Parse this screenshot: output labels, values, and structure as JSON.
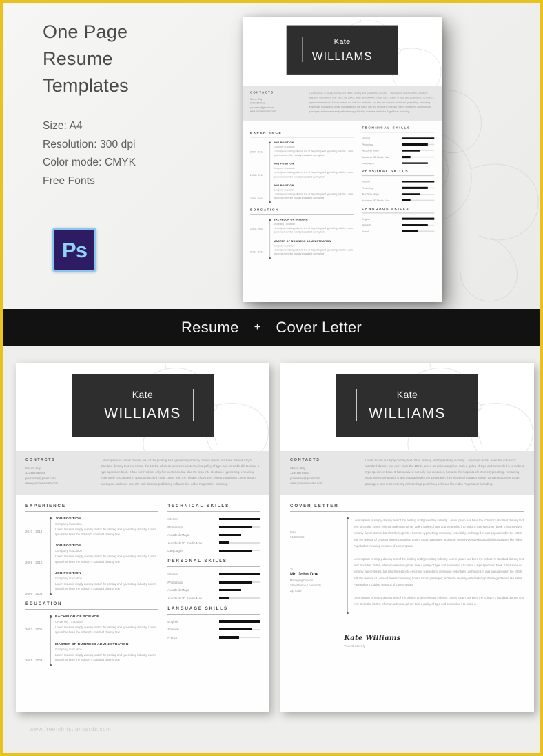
{
  "theme": {
    "border_color": "#e9c21d",
    "banner_bg": "#121212",
    "namebar_bg": "#2e2e2e",
    "accent_bar": "#111111",
    "page_bg": "#f2f2f0"
  },
  "hero": {
    "title_lines": [
      "One Page",
      "Resume",
      "Templates"
    ],
    "specs": [
      "Size: A4",
      "Resolution: 300 dpi",
      "Color mode: CMYK",
      "Free Fonts"
    ],
    "app_icon_label": "Ps",
    "app_icon_name": "photoshop-icon"
  },
  "banner": {
    "left_label": "Resume",
    "separator": "+",
    "right_label": "Cover Letter"
  },
  "resume": {
    "name_first": "Kate",
    "name_last": "WILLIAMS",
    "contacts": {
      "title": "CONTACTS",
      "lines": [
        "Street, City",
        "123456789xxx",
        "yourname@gmail.com",
        "www.yourownname.com"
      ],
      "intro": "Lorem Ipsum is simply dummy text of the printing and typesetting industry. Lorem Ipsum has been the industry's standard dummy text ever since the 1500s, when an unknown printer took a galley of type and scrambled it to make a type specimen book. It has survived not only five centuries, but also the leap into electronic typesetting, remaining essentially unchanged. It was popularised in the 1960s with the release of Letraset sheets containing Lorem Ipsum passages, and more recently with desktop publishing software like Aldus PageMaker including."
    },
    "experience": {
      "title": "EXPERIENCE",
      "items": [
        {
          "date": "2010 - 2012",
          "role": "JOB POSITION",
          "sub": "Company / Location",
          "desc": "Lorem Ipsum is simply dummy text of the printing and typesetting industry. Lorem Ipsum has been the industry's standard dummy text"
        },
        {
          "date": "2008 - 2010",
          "role": "JOB POSITION",
          "sub": "Company / Location",
          "desc": "Lorem Ipsum is simply dummy text of the printing and typesetting industry. Lorem Ipsum has been the industry's standard dummy text"
        },
        {
          "date": "2006 - 2008",
          "role": "JOB POSITION",
          "sub": "Company / Location",
          "desc": "Lorem Ipsum is simply dummy text of the printing and typesetting industry. Lorem Ipsum has been the industry's standard dummy text"
        }
      ]
    },
    "education": {
      "title": "EDUCATION",
      "items": [
        {
          "date": "2003 - 2005",
          "role": "BACHELOR OF SCIENCE",
          "sub": "University / Location",
          "desc": "Lorem Ipsum is simply dummy text of the printing and typesetting industry. Lorem Ipsum has been the industry's standard dummy text"
        },
        {
          "date": "2001 - 2003",
          "role": "MASTER OF BUSINESS ADMINISTRATION",
          "sub": "Company / Location",
          "desc": "Lorem Ipsum is simply dummy text of the printing and typesetting industry. Lorem Ipsum has been the industry's standard dummy text"
        }
      ]
    },
    "technical_skills": {
      "title": "TECHNICAL SKILLS",
      "items": [
        {
          "label": "Internet",
          "value": 100
        },
        {
          "label": "Photoshop",
          "value": 80
        },
        {
          "label": "Autodesk Maya",
          "value": 55
        },
        {
          "label": "Autodesk 3D Studio Max",
          "value": 25
        },
        {
          "label": "Languages",
          "value": 80
        }
      ]
    },
    "personal_skills": {
      "title": "PERSONAL SKILLS",
      "items": [
        {
          "label": "Internet",
          "value": 100
        },
        {
          "label": "Photoshop",
          "value": 80
        },
        {
          "label": "Autodesk Maya",
          "value": 55
        },
        {
          "label": "Autodesk 3D Studio Max",
          "value": 25
        }
      ]
    },
    "language_skills": {
      "title": "LANGUAGE SKILLS",
      "items": [
        {
          "label": "English",
          "value": 100
        },
        {
          "label": "Spanish",
          "value": 80
        },
        {
          "label": "French",
          "value": 50
        }
      ]
    }
  },
  "cover_letter": {
    "title": "COVER LETTER",
    "date_label": "Date",
    "date_value": "04/02/2016",
    "to_label": "To",
    "recipient_name": "Mr. John Doe",
    "recipient_role": "Managing Director",
    "recipient_address": "Street Name, Lorem City",
    "recipient_zip": "Zip Code",
    "paragraphs": [
      "Lorem Ipsum is simply dummy text of the printing and typesetting industry. Lorem Ipsum has been the industry's standard dummy text ever since the 1500s, when an unknown printer took a galley of type and scrambled it to make a type specimen book. It has survived not only five centuries, but also the leap into electronic typesetting, remaining essentially unchanged. It was popularised in the 1960s with the release of Letraset sheets containing Lorem Ipsum passages, and more recently with desktop publishing software like Aldus PageMaker including versions of Lorem Ipsum.",
      "Lorem Ipsum is simply dummy text of the printing and typesetting industry. Lorem Ipsum has been the industry's standard dummy text ever since the 1500s, when an unknown printer took a galley of type and scrambled it to make a type specimen book. It has survived not only five centuries, but also the leap into electronic typesetting, remaining essentially unchanged. It was popularised in the 1960s with the release of Letraset sheets containing Lorem Ipsum passages, and more recently with desktop publishing software like Aldus PageMaker including versions of Lorem Ipsum.",
      "Lorem Ipsum is simply dummy text of the printing and typesetting industry. Lorem Ipsum has been the industry's standard dummy text ever since the 1500s, when an unknown printer took a galley of type and scrambled it to make a."
    ],
    "signature_name": "Kate Williams",
    "signature_sub": "Your Sincerely"
  },
  "footer": {
    "watermark": "www.free-christiancards.com"
  }
}
